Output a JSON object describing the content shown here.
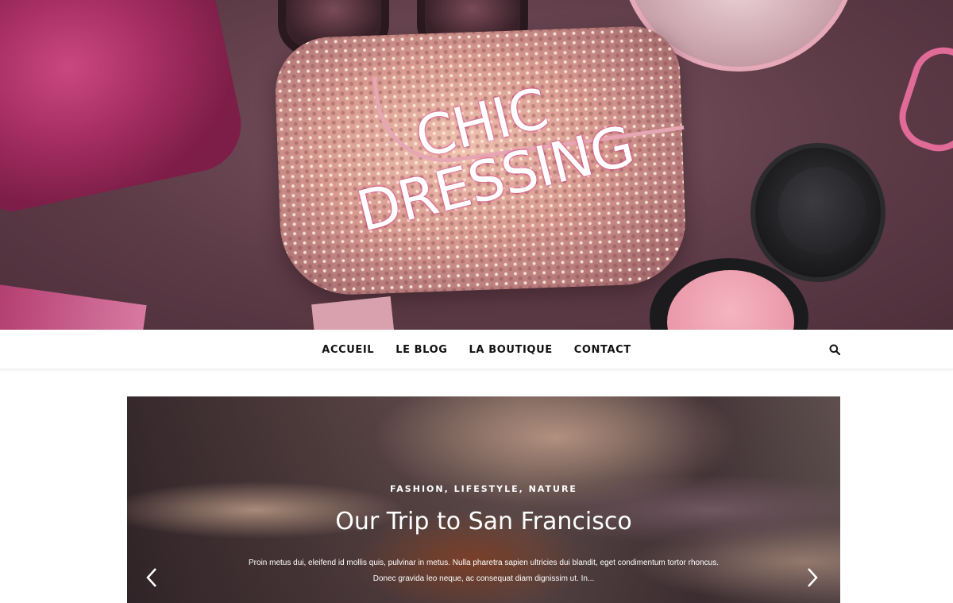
{
  "site": {
    "title_line1": "CHIC",
    "title_line2": "DRESSING"
  },
  "nav": {
    "items": [
      {
        "label": "ACCUEIL"
      },
      {
        "label": "LE BLOG"
      },
      {
        "label": "LA BOUTIQUE"
      },
      {
        "label": "CONTACT"
      }
    ],
    "search_icon": "search-icon"
  },
  "slider": {
    "categories": "FASHION, LIFESTYLE, NATURE",
    "title": "Our Trip to San Francisco",
    "excerpt": "Proin metus dui, eleifend id mollis quis, pulvinar in metus. Nulla pharetra sapien ultricies dui blandit, eget condimentum tortor rhoncus. Donec gravida leo neque, ac consequat diam dignissim ut. In...",
    "prev_icon": "chevron-left-icon",
    "next_icon": "chevron-right-icon"
  }
}
